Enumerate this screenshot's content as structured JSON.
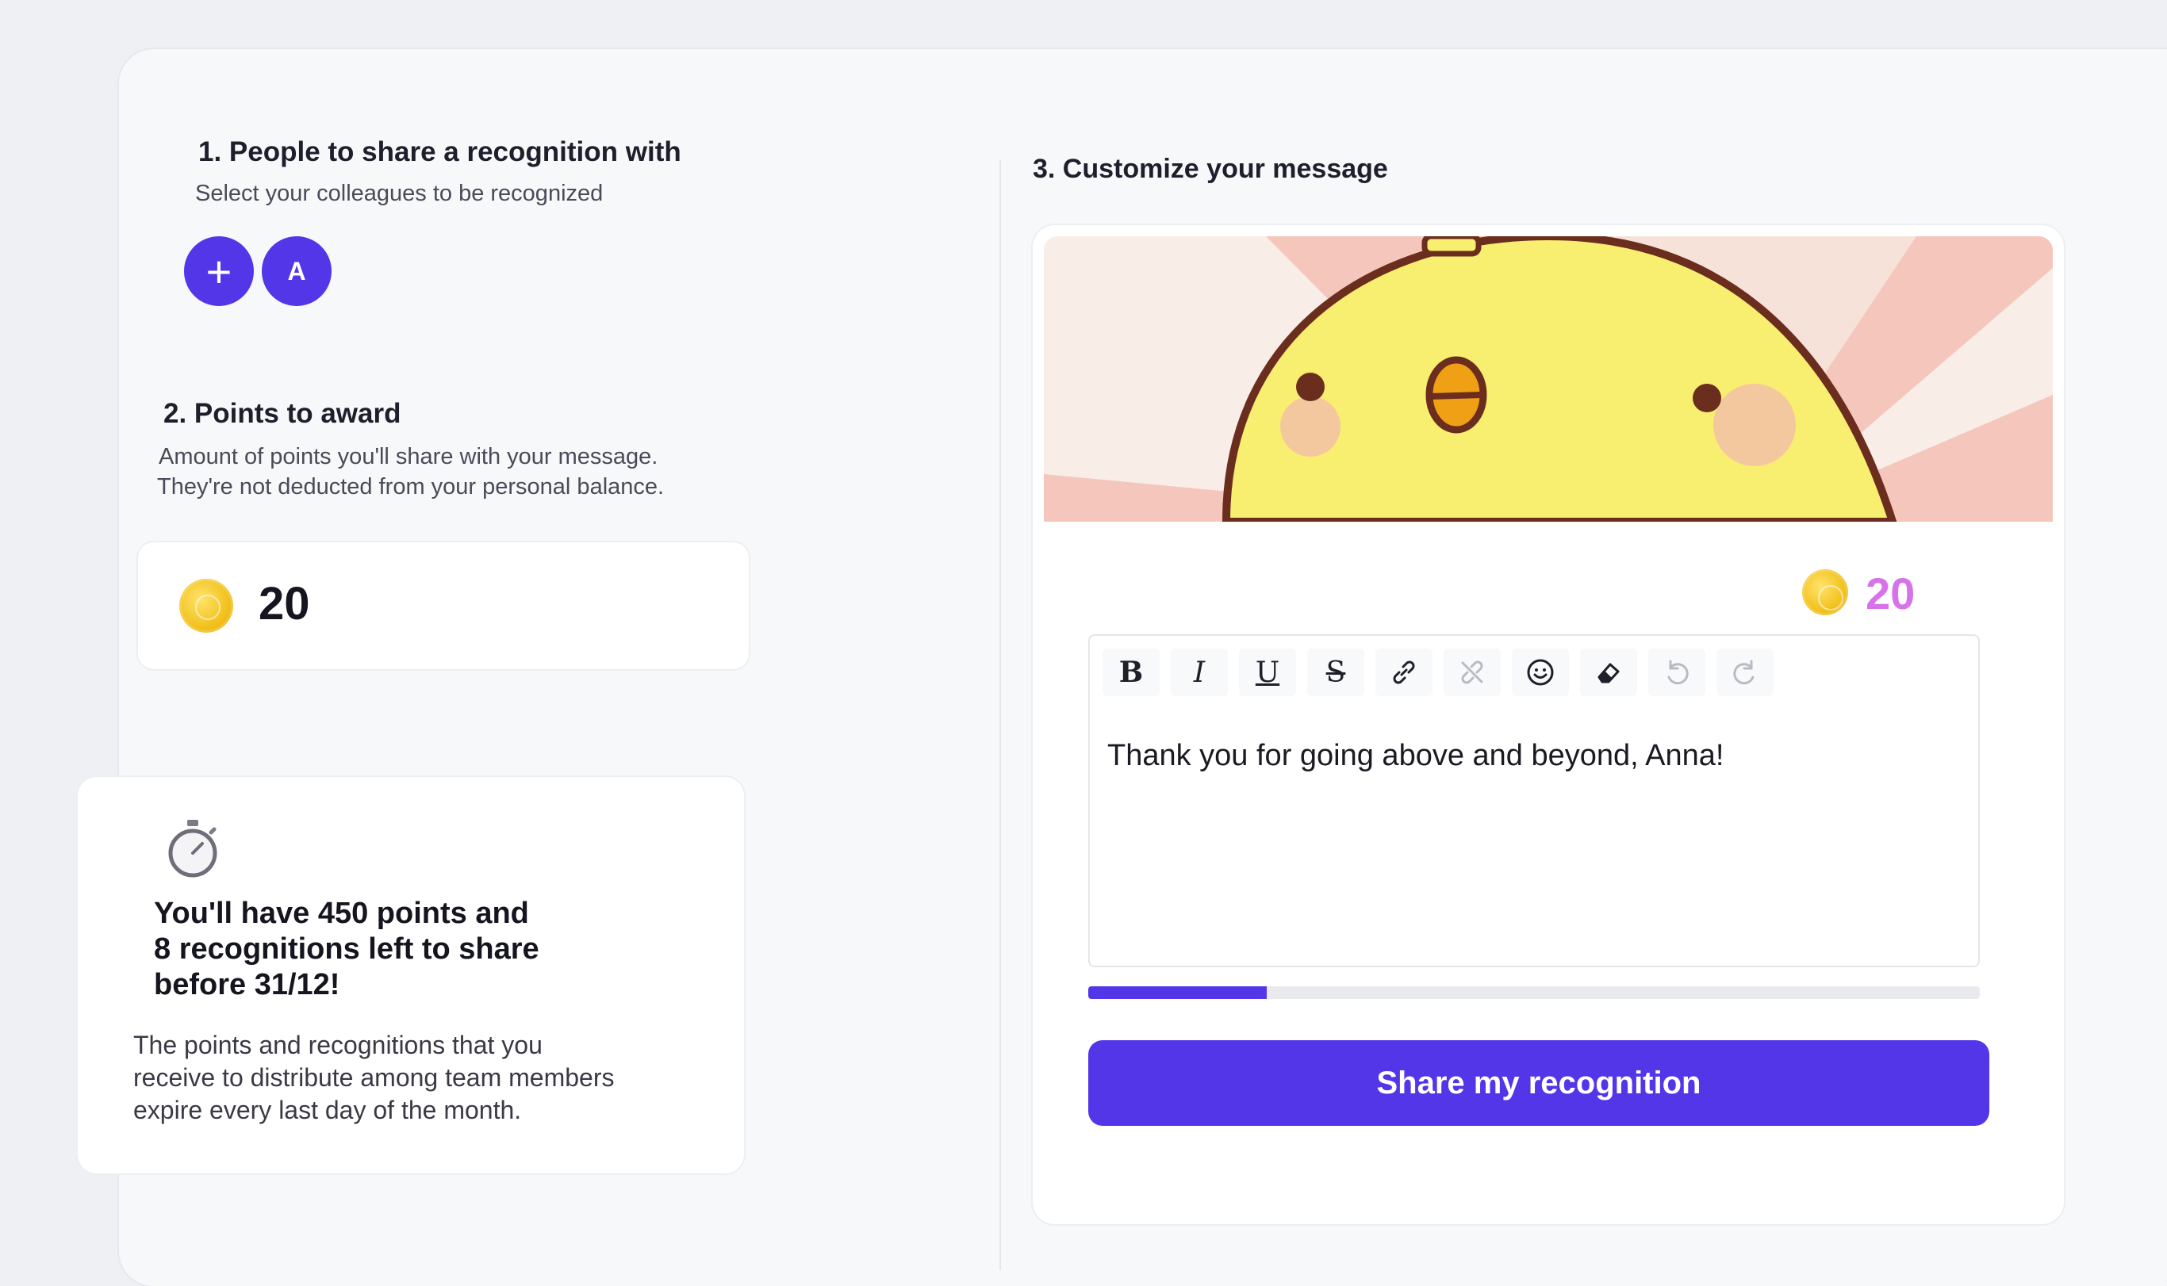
{
  "step1": {
    "title": "1. People to share a recognition with",
    "subtitle": "Select your colleagues to be recognized",
    "add_button_icon": "+",
    "selected_avatar_initial": "A"
  },
  "step2": {
    "title": "2. Points to award",
    "subtitle_line1": "Amount of points you'll share with your message.",
    "subtitle_line2": "They're not deducted from your personal balance.",
    "points_value": "20",
    "coin_icon": "coin-icon"
  },
  "info_card": {
    "icon": "stopwatch-icon",
    "heading_line1": "You'll have 450 points and",
    "heading_line2": "8 recognitions left to share",
    "heading_line3": "before 31/12!",
    "body_line1": "The points and recognitions that you",
    "body_line2": "receive to distribute among team members",
    "body_line3": "expire every last day of the month."
  },
  "step3": {
    "title": "3. Customize your message",
    "points_badge": "20",
    "toolbar": {
      "bold": "B",
      "italic": "I",
      "underline": "U",
      "strikethrough": "S"
    },
    "message_text": "Thank you for going above and beyond, Anna!",
    "character_progress": 0.2,
    "share_button_label": "Share my recognition"
  },
  "colors": {
    "accent": "#5236e8",
    "points_pink": "#d773e8",
    "coin_gold": "#f2c11d",
    "banner_yellow": "#f7ef73"
  }
}
